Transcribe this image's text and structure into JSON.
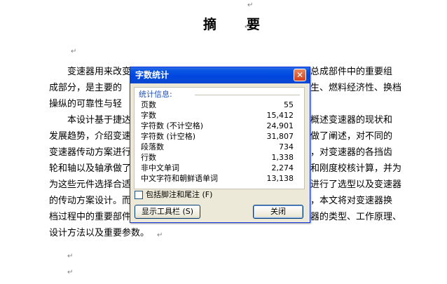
{
  "document": {
    "title": "摘　要",
    "lines": [
      "变速器用来改变",
      "成部分，是主要的",
      "操纵的可靠性与轻",
      "本设计基于捷达",
      "发展趋势，介绍变速",
      "变速器传动方案进行",
      "轮和轴以及轴承做了",
      "为这些元件选择合适",
      "的传动方案设计。而",
      "档过程中的重要部件",
      "设计方法以及重要参数。"
    ],
    "right_lines": [
      "总成部件中的重要组",
      "生、燃料经济性、换档",
      "概述变速器的现状和",
      "做了阐述，对不同的",
      "，对变速器的各挡齿",
      "和刚度校核计算，并为",
      "进行了选型以及变速器",
      "，本文将对变速器换",
      "器的类型、工作原理、"
    ],
    "paragraph_mark": "↵"
  },
  "dialog": {
    "title": "字数统计",
    "close_glyph": "✕",
    "stats_header": "统计信息:",
    "stats": [
      {
        "label": "页数",
        "value": "55"
      },
      {
        "label": "字数",
        "value": "15,412"
      },
      {
        "label": "字符数 (不计空格)",
        "value": "24,901"
      },
      {
        "label": "字符数 (计空格)",
        "value": "31,807"
      },
      {
        "label": "段落数",
        "value": "734"
      },
      {
        "label": "行数",
        "value": "1,338"
      },
      {
        "label": "非中文单词",
        "value": "2,274"
      },
      {
        "label": "中文字符和朝鲜语单词",
        "value": "13,138"
      }
    ],
    "checkbox_label": "包括脚注和尾注 (F)",
    "checkbox_checked": false,
    "toolbar_button": "显示工具栏 (S)",
    "close_button": "关闭"
  },
  "colors": {
    "titlebar": "#0a55e3",
    "dialog_bg": "#ece9d8",
    "close_red": "#d5401b",
    "header_blue": "#1c4fba"
  }
}
